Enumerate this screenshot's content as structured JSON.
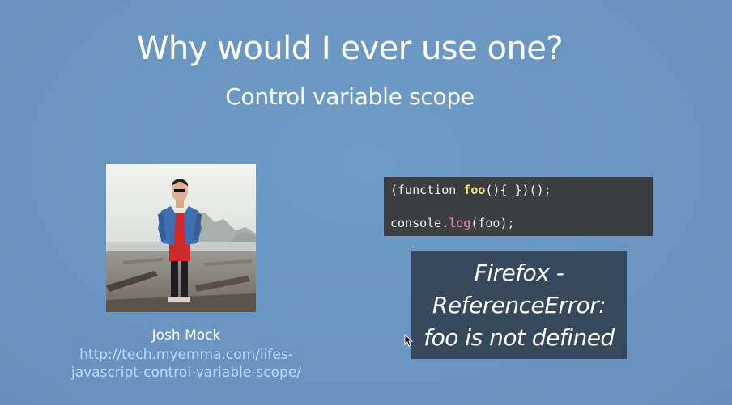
{
  "slide": {
    "title": "Why would I ever use one?",
    "subtitle": "Control variable scope"
  },
  "author": {
    "name": "Josh Mock",
    "url_line1": "http://tech.myemma.com/iifes-",
    "url_line2": "javascript-control-variable-scope/"
  },
  "code": {
    "line1_open": "(function ",
    "line1_fn": "foo",
    "line1_rest": "(){ })();",
    "line2_obj": "console.",
    "line2_method": "log",
    "line2_rest": "(foo);"
  },
  "result": {
    "line1": "Firefox -",
    "line2": "ReferenceError:",
    "line3": "foo is not defined"
  },
  "colors": {
    "background": "#6a96c1",
    "code_bg": "#3d3e40",
    "result_bg": "#36495c",
    "link": "#b7dcff",
    "fn_highlight": "#f0e68c",
    "method_highlight": "#e88ab4"
  }
}
